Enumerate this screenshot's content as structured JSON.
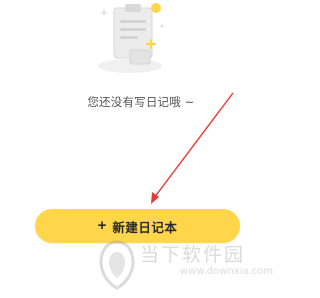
{
  "empty_state": {
    "message": "您还没有写日记哦 ~"
  },
  "actions": {
    "new_diary_label": "新建日记本",
    "plus_symbol": "+"
  },
  "watermark": {
    "title": "当下软件园",
    "url": "www.downxia.com"
  },
  "colors": {
    "button_bg": "#ffd54a",
    "arrow": "#e53935",
    "text": "#555555"
  },
  "icons": {
    "illustration": "empty-clipboard-illustration",
    "button": "plus-icon"
  }
}
